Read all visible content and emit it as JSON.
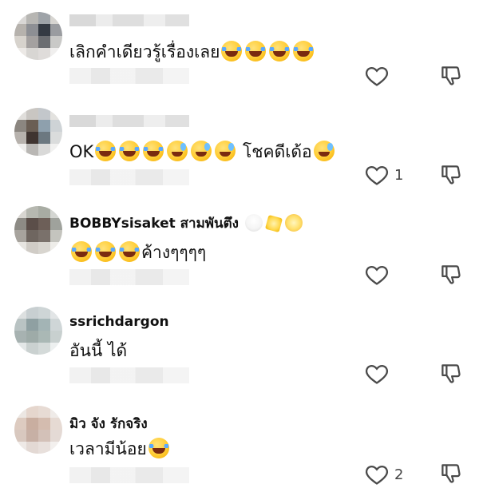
{
  "comments": [
    {
      "author": "",
      "text_prefix": "เลิกคำเดียวรู้เรื่องเลย",
      "emojis": [
        "laugh",
        "laugh",
        "laugh",
        "laugh"
      ],
      "text_suffix": "",
      "likes": ""
    },
    {
      "author": "",
      "text_prefix": "OK",
      "emojis": [
        "laugh",
        "laugh",
        "laugh",
        "sweat",
        "sweat",
        "sweat"
      ],
      "text_suffix": "โชคดีเด้อ",
      "suffix_emoji": "sweat",
      "likes": "1"
    },
    {
      "author": "BOBBYsisaket สามพันตึง",
      "author_emojis": [
        "rooster",
        "star",
        "dizzy"
      ],
      "text_prefix": "",
      "emojis": [
        "laugh",
        "laugh",
        "laugh"
      ],
      "text_suffix": "ค้างๆๆๆๆ",
      "likes": ""
    },
    {
      "author": "ssrichdargon",
      "text_prefix": "อันนี้ ได้",
      "emojis": [],
      "text_suffix": "",
      "likes": ""
    },
    {
      "author": "มิว จัง รักจริง",
      "text_prefix": "เวลามีน้อย",
      "emojis": [
        "laugh"
      ],
      "text_suffix": "",
      "likes": "2"
    }
  ],
  "icons": {
    "like": "heart-outline-icon",
    "dislike": "thumbs-down-outline-icon"
  }
}
